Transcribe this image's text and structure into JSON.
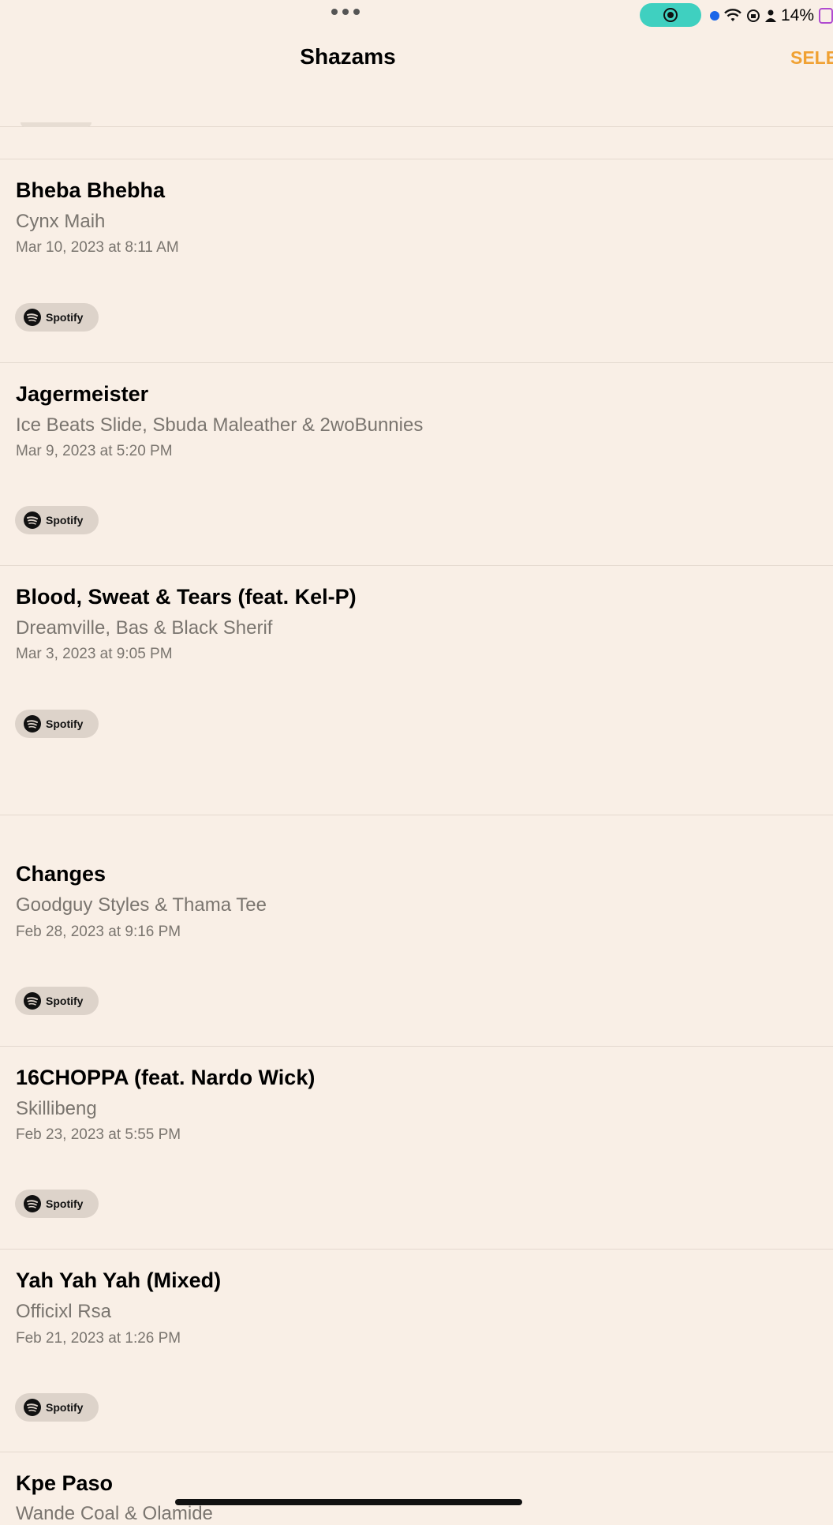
{
  "status_bar": {
    "battery_text": "14%"
  },
  "nav": {
    "title": "Shazams",
    "select_label": "SELE"
  },
  "spotify_label": "Spotify",
  "tracks": [
    {
      "title": "Bheba Bhebha",
      "artist": "Cynx Maih",
      "date": "Mar 10, 2023 at 8:11 AM"
    },
    {
      "title": "Jagermeister",
      "artist": "Ice Beats Slide, Sbuda Maleather & 2woBunnies",
      "date": "Mar 9, 2023 at 5:20 PM"
    },
    {
      "title": "Blood, Sweat & Tears (feat. Kel-P)",
      "artist": "Dreamville, Bas & Black Sherif",
      "date": "Mar 3, 2023 at 9:05 PM"
    },
    {
      "title": "Changes",
      "artist": "Goodguy Styles & Thama Tee",
      "date": "Feb 28, 2023 at 9:16 PM"
    },
    {
      "title": "16CHOPPA (feat. Nardo Wick)",
      "artist": "Skillibeng",
      "date": "Feb 23, 2023 at 5:55 PM"
    },
    {
      "title": "Yah Yah Yah (Mixed)",
      "artist": "Officixl Rsa",
      "date": "Feb 21, 2023 at 1:26 PM"
    },
    {
      "title": "Kpe Paso",
      "artist": "Wande Coal & Olamide",
      "date": ""
    }
  ]
}
